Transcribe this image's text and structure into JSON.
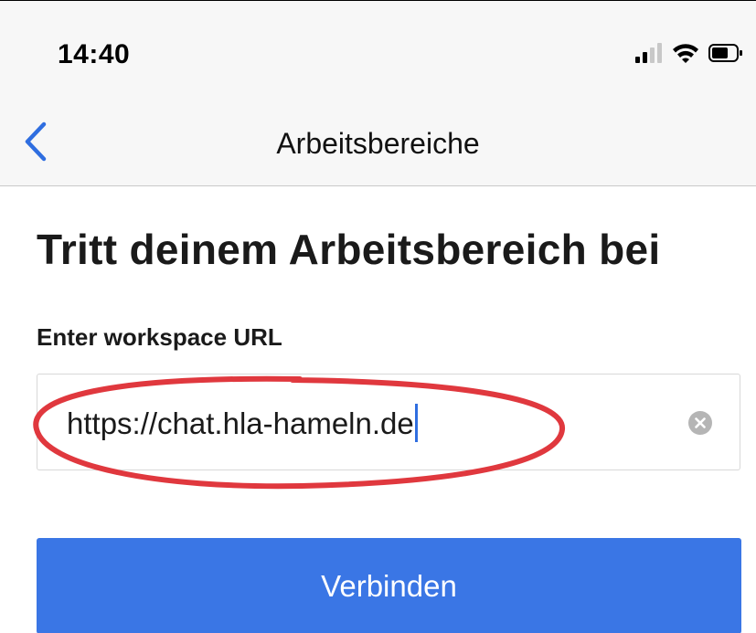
{
  "status_bar": {
    "time": "14:40",
    "icons": [
      "cellular-signal-icon",
      "wifi-icon",
      "battery-icon"
    ]
  },
  "nav": {
    "back_icon": "chevron-left-icon",
    "title": "Arbeitsbereiche"
  },
  "main": {
    "heading": "Tritt deinem Arbeitsbereich bei",
    "url_label": "Enter workspace URL",
    "url_value": "https://chat.hla-hameln.de",
    "clear_icon": "clear-circle-icon",
    "connect_label": "Verbinden"
  },
  "colors": {
    "accent": "#3a76e5",
    "back_chevron": "#2f6ee0",
    "annotation_ellipse": "#e0383e",
    "bar_background": "#f7f7f7"
  }
}
